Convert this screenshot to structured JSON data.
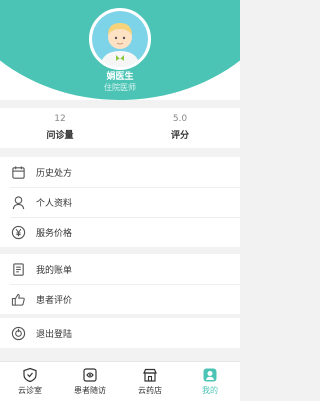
{
  "profile": {
    "name": "娟医生",
    "title": "住院医师"
  },
  "stats": [
    {
      "value": "12",
      "label": "问诊量"
    },
    {
      "value": "5.0",
      "label": "评分"
    }
  ],
  "menu_group1": [
    {
      "label": "历史处方",
      "icon": "calendar-icon"
    },
    {
      "label": "个人资料",
      "icon": "person-icon"
    },
    {
      "label": "服务价格",
      "icon": "yen-icon"
    }
  ],
  "menu_group2": [
    {
      "label": "我的账单",
      "icon": "bill-icon"
    },
    {
      "label": "患者评价",
      "icon": "thumbs-up-icon"
    }
  ],
  "menu_group3": [
    {
      "label": "退出登陆",
      "icon": "power-icon"
    }
  ],
  "tabs": [
    {
      "label": "云诊室",
      "icon": "shield-icon"
    },
    {
      "label": "患者随访",
      "icon": "followup-icon"
    },
    {
      "label": "云药店",
      "icon": "store-icon"
    },
    {
      "label": "我的",
      "icon": "profile-icon",
      "active": true
    }
  ],
  "colors": {
    "accent": "#4cc4b5",
    "icon": "#555555"
  }
}
